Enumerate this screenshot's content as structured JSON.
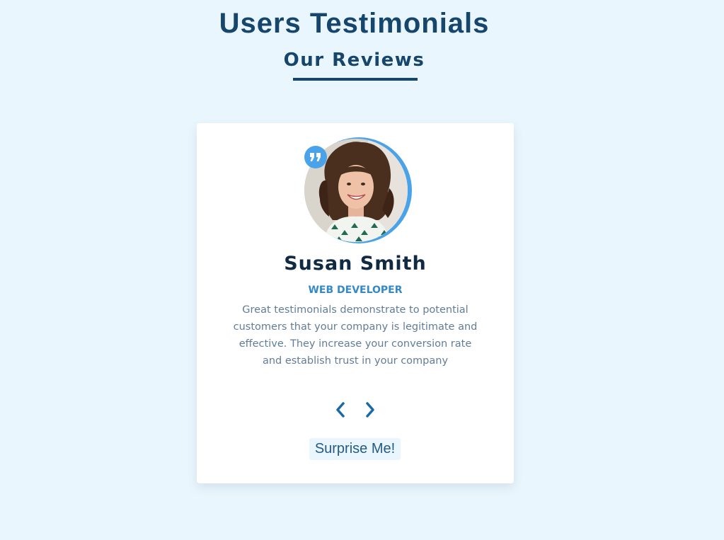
{
  "header": {
    "title": "Users Testimonials",
    "subtitle": "Our Reviews"
  },
  "review": {
    "name": "Susan Smith",
    "job": "WEB DEVELOPER",
    "text": "Great testimonials demonstrate to potential customers that your company is legitimate and effective. They increase your conversion rate and establish trust in your company"
  },
  "controls": {
    "random_label": "Surprise Me!"
  },
  "icons": {
    "quote": "quote-icon",
    "prev": "chevron-left-icon",
    "next": "chevron-right-icon"
  },
  "colors": {
    "background": "#eaf6fd",
    "title": "#17466d",
    "accent": "#4aa3e8",
    "job": "#3489c6",
    "text": "#627d98",
    "card": "#ffffff"
  }
}
